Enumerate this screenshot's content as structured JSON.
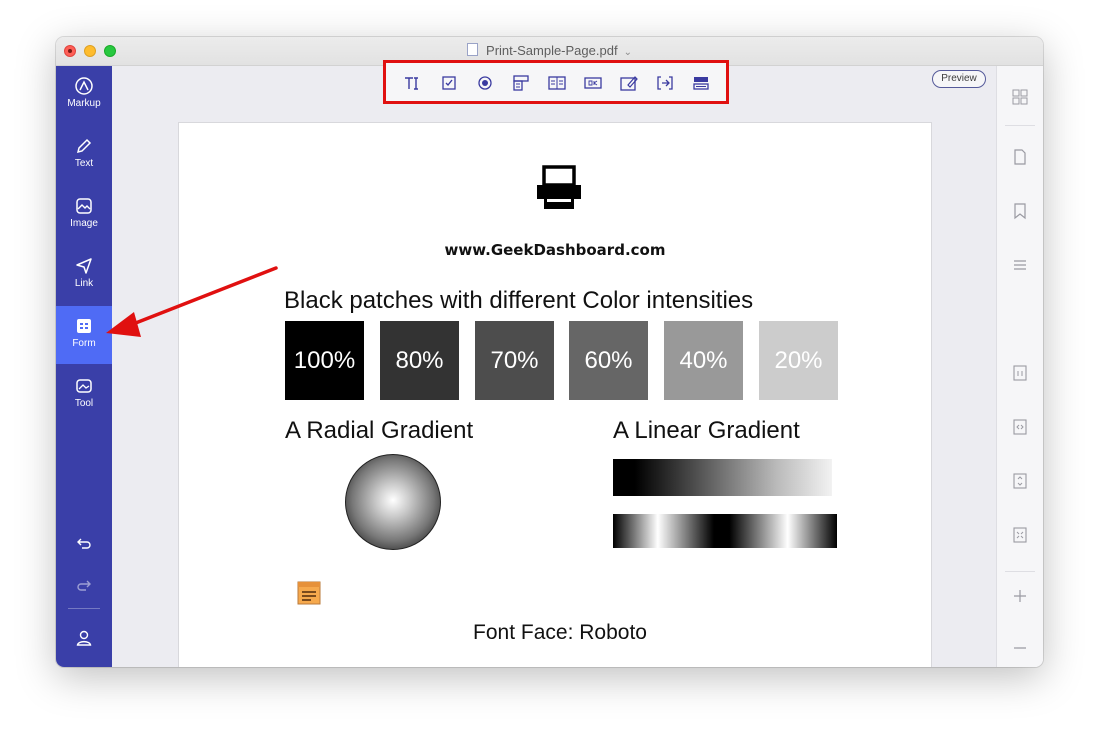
{
  "window": {
    "title": "Print-Sample-Page.pdf",
    "title_chevron": "⌄"
  },
  "sidebar": {
    "items": [
      {
        "label": "Markup",
        "icon": "markup-icon"
      },
      {
        "label": "Text",
        "icon": "pencil-icon"
      },
      {
        "label": "Image",
        "icon": "image-icon"
      },
      {
        "label": "Link",
        "icon": "link-send-icon"
      },
      {
        "label": "Form",
        "icon": "form-icon",
        "active": true
      },
      {
        "label": "Tool",
        "icon": "toolbox-icon"
      }
    ],
    "bottom": [
      "undo-icon",
      "redo-icon",
      "user-icon"
    ]
  },
  "toolbar": {
    "tools": [
      "text-field-icon",
      "checkbox-icon",
      "radio-button-icon",
      "combo-box-icon",
      "list-box-icon",
      "button-icon",
      "signature-field-icon",
      "align-icon",
      "more-forms-icon"
    ],
    "preview_label": "Preview",
    "highlight_color": "#e01010"
  },
  "document": {
    "url_text": "www.GeekDashboard.com",
    "heading": "Black patches with different Color intensities",
    "patches": [
      {
        "label": "100%",
        "color": "#000000"
      },
      {
        "label": "80%",
        "color": "#333333"
      },
      {
        "label": "70%",
        "color": "#4d4d4d"
      },
      {
        "label": "60%",
        "color": "#666666"
      },
      {
        "label": "40%",
        "color": "#999999"
      },
      {
        "label": "20%",
        "color": "#cccccc"
      }
    ],
    "radial_title": "A Radial Gradient",
    "linear_title": "A Linear Gradient",
    "font_face": "Font Face: Roboto"
  },
  "rightbar": {
    "icons": [
      "thumbnails-icon",
      "page-icon",
      "bookmark-icon",
      "outline-icon",
      "actual-size-icon",
      "fit-width-icon",
      "fit-height-icon",
      "fit-page-icon",
      "zoom-in-icon",
      "zoom-out-icon"
    ]
  },
  "colors": {
    "sidebar": "#3a3fa8",
    "sidebar_active": "#4f6bf5",
    "annotation_red": "#e01010"
  }
}
